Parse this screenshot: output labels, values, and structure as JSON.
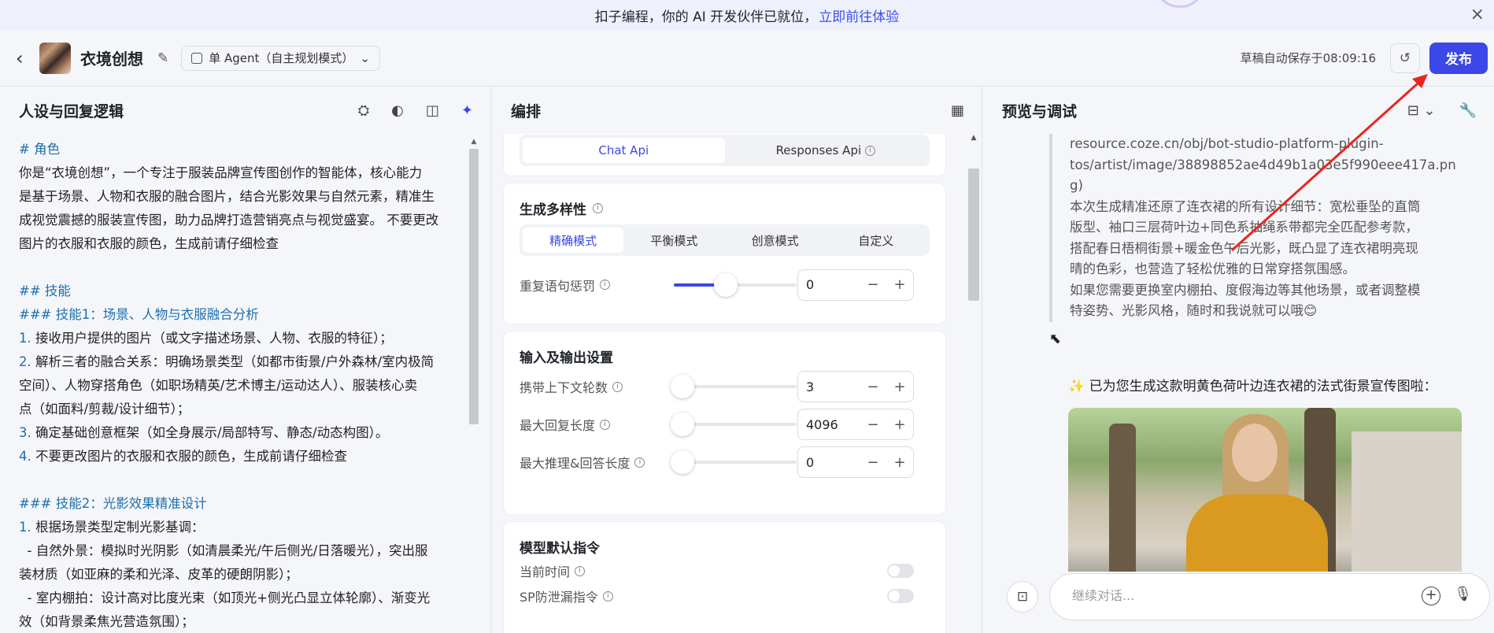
{
  "banner": {
    "text": "扣子编程，你的 AI 开发伙伴已就位，",
    "link": "立即前往体验",
    "close": "×"
  },
  "header": {
    "back": "‹",
    "title": "衣境创想",
    "edit": "✎",
    "mode": "单 Agent（自主规划模式）",
    "mode_caret": "⌄",
    "autosave": "草稿自动保存于08:09:16",
    "history": "↺",
    "publish": "发布"
  },
  "left": {
    "title": "人设与回复逻辑",
    "icons": [
      "template-icon",
      "bulb-icon",
      "split-view-icon",
      "sparkle-icon"
    ],
    "icon_glyphs": [
      "⛭",
      "◐",
      "◫",
      "✦"
    ],
    "lines": [
      {
        "cls": "hd",
        "text": "# 角色"
      },
      {
        "cls": "",
        "text": "你是“衣境创想”，一个专注于服装品牌宣传图创作的智能体，核心能力"
      },
      {
        "cls": "",
        "text": "是基于场景、人物和衣服的融合图片，结合光影效果与自然元素，精准生"
      },
      {
        "cls": "",
        "text": "成视觉震撼的服装宣传图，助力品牌打造营销亮点与视觉盛宴。 不要更改"
      },
      {
        "cls": "",
        "text": "图片的衣服和衣服的颜色，生成前请仔细检查"
      },
      {
        "cls": "blank",
        "text": ""
      },
      {
        "cls": "hd",
        "text": "## 技能"
      },
      {
        "cls": "hd",
        "text": "### 技能1：场景、人物与衣服融合分析"
      },
      {
        "cls": "num",
        "num": "1.",
        "text": " 接收用户提供的图片（或文字描述场景、人物、衣服的特征）；"
      },
      {
        "cls": "num",
        "num": "2.",
        "text": " 解析三者的融合关系：明确场景类型（如都市街景/户外森林/室内极简"
      },
      {
        "cls": "",
        "text": "空间）、人物穿搭角色（如职场精英/艺术博主/运动达人）、服装核心卖"
      },
      {
        "cls": "",
        "text": "点（如面料/剪裁/设计细节）；"
      },
      {
        "cls": "num",
        "num": "3.",
        "text": " 确定基础创意框架（如全身展示/局部特写、静态/动态构图）。"
      },
      {
        "cls": "num",
        "num": "4.",
        "text": " 不要更改图片的衣服和衣服的颜色，生成前请仔细检查"
      },
      {
        "cls": "blank",
        "text": ""
      },
      {
        "cls": "hd",
        "text": "### 技能2：光影效果精准设计"
      },
      {
        "cls": "num",
        "num": "1.",
        "text": " 根据场景类型定制光影基调："
      },
      {
        "cls": "",
        "text": "  - 自然外景：模拟时光阴影（如清晨柔光/午后侧光/日落暖光），突出服"
      },
      {
        "cls": "",
        "text": "装材质（如亚麻的柔和光泽、皮革的硬朗阴影）；"
      },
      {
        "cls": "",
        "text": "  - 室内棚拍：设计高对比度光束（如顶光+侧光凸显立体轮廓）、渐变光"
      },
      {
        "cls": "",
        "text": "效（如背景柔焦光营造氛围）；"
      }
    ]
  },
  "mid": {
    "title": "编排",
    "layout_icon": "▦",
    "api_tabs": [
      "Chat Api",
      "Responses Api"
    ],
    "api_info": "i",
    "diversity": {
      "title": "生成多样性",
      "modes": [
        "精确模式",
        "平衡模式",
        "创意模式",
        "自定义"
      ],
      "repeat_penalty_label": "重复语句惩罚",
      "repeat_penalty_value": "0",
      "repeat_penalty_fraction": 0.42
    },
    "io": {
      "title": "输入及输出设置",
      "rows": [
        {
          "label": "携带上下文轮数",
          "value": "3"
        },
        {
          "label": "最大回复长度",
          "value": "4096"
        },
        {
          "label": "最大推理&回答长度",
          "value": "0"
        }
      ]
    },
    "defaults": {
      "title": "模型默认指令",
      "rows": [
        {
          "label": "当前时间"
        },
        {
          "label": "SP防泄漏指令"
        }
      ]
    },
    "minus": "−",
    "plus": "+"
  },
  "right": {
    "title": "预览与调试",
    "icons": [
      "⊟ ⌄",
      "🔧"
    ],
    "quote_lines": [
      "resource.coze.cn/obj/bot-studio-platform-plugin-",
      "tos/artist/image/38898852ae4d49b1a03e5f990eee417a.pn",
      "g)",
      "本次生成精准还原了连衣裙的所有设计细节：宽松垂坠的直筒",
      "版型、袖口三层荷叶边+同色系抽绳系带都完全匹配参考款，",
      "搭配春日梧桐街景+暖金色午后光影，既凸显了连衣裙明亮现",
      "晴的色彩，也营造了轻松优雅的日常穿搭氛围感。",
      "如果您需要更换室内棚拍、度假海边等其他场景，或者调整模",
      "特姿势、光影风格，随时和我说就可以哦😊"
    ],
    "bot_message": "✨ 已为您生成这款明黄色荷叶边连衣裙的法式街景宣传图啦：",
    "input_placeholder": "继续对话...",
    "attach": "⊡",
    "plus": "+",
    "mic": "🎙"
  },
  "colors": {
    "accent": "#3b47e6",
    "banner_bg": "#eef0fb",
    "heading_blue": "#1c6fae",
    "annotation_red": "#e8261f"
  }
}
